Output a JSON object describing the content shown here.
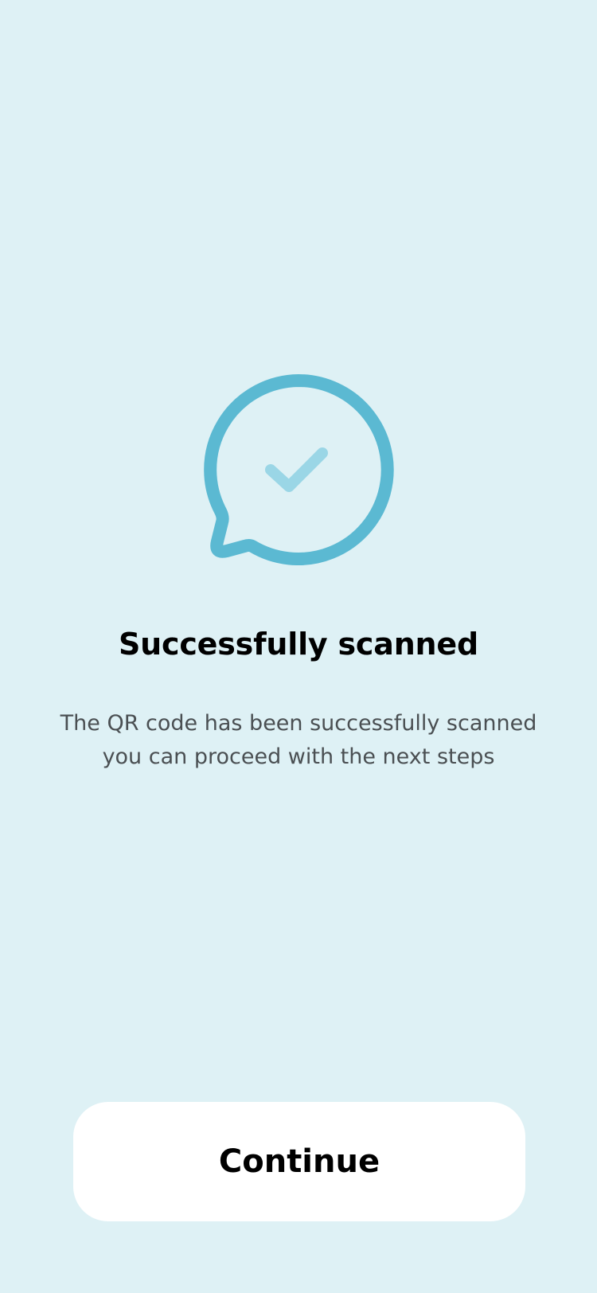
{
  "screen": {
    "title": "Successfully scanned",
    "description_line1": "The QR code has been successfully scanned",
    "description_line2": "you can proceed with the next steps"
  },
  "actions": {
    "continue_label": "Continue"
  },
  "icon": {
    "name": "chat-bubble-check-icon"
  },
  "colors": {
    "background": "#DEF1F5",
    "accent": "#5BB9D2",
    "accent_light": "#9AD6E6",
    "button_bg": "#FFFFFF",
    "title_text": "#000000",
    "body_text": "#4A4F52"
  }
}
